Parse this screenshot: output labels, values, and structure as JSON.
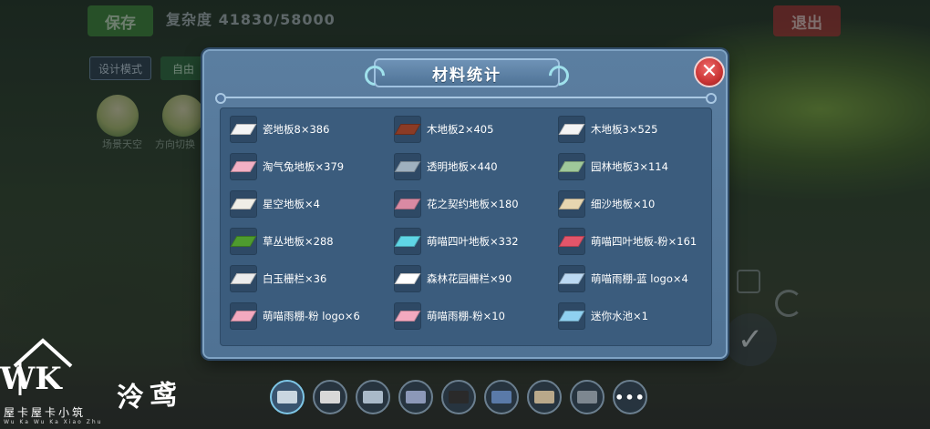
{
  "hud": {
    "save_label": "保存",
    "complexity": "复杂度 41830/58000",
    "exit_label": "退出",
    "design_mode_label": "设计模式",
    "free_mode_label": "自由",
    "tool_left_caption": "场景天空",
    "tool_right_caption": "方向切换"
  },
  "dialog": {
    "title": "材料统计",
    "close_glyph": "✕",
    "materials": [
      {
        "name": "瓷地板8×386",
        "tile_color": "#f4f4f4"
      },
      {
        "name": "木地板2×405",
        "tile_color": "#8b3b25"
      },
      {
        "name": "木地板3×525",
        "tile_color": "#f4f4f4"
      },
      {
        "name": "淘气兔地板×379",
        "tile_color": "#f2b0c4"
      },
      {
        "name": "透明地板×440",
        "tile_color": "#9fb1bf"
      },
      {
        "name": "园林地板3×114",
        "tile_color": "#9fc89a"
      },
      {
        "name": "星空地板×4",
        "tile_color": "#f0eee6"
      },
      {
        "name": "花之契约地板×180",
        "tile_color": "#d98aa3"
      },
      {
        "name": "细沙地板×10",
        "tile_color": "#e7d6b0"
      },
      {
        "name": "草丛地板×288",
        "tile_color": "#4e9b2e"
      },
      {
        "name": "萌喵四叶地板×332",
        "tile_color": "#5fd6e6"
      },
      {
        "name": "萌喵四叶地板-粉×161",
        "tile_color": "#e2556a"
      },
      {
        "name": "白玉栅栏×36",
        "tile_color": "#ececec"
      },
      {
        "name": "森林花园栅栏×90",
        "tile_color": "#ffffff"
      },
      {
        "name": "萌喵雨棚-蓝 logo×4",
        "tile_color": "#bcd9f2"
      },
      {
        "name": "萌喵雨棚-粉 logo×6",
        "tile_color": "#f3a9bf"
      },
      {
        "name": "萌喵雨棚-粉×10",
        "tile_color": "#f3a9bf"
      },
      {
        "name": "迷你水池×1",
        "tile_color": "#8fd0f0"
      }
    ]
  },
  "toolbar": {
    "items": [
      {
        "name": "eraser-tool",
        "color": "#c9d6e0"
      },
      {
        "name": "fence-tool",
        "color": "#d8d8d8"
      },
      {
        "name": "arch-tool",
        "color": "#a9b9c8"
      },
      {
        "name": "gate-tool",
        "color": "#8c98b8"
      },
      {
        "name": "dark-block-tool",
        "color": "#2a2a2a"
      },
      {
        "name": "trash-bin-tool",
        "color": "#5a7aa8"
      },
      {
        "name": "beige-tile-tool",
        "color": "#b9a88a"
      },
      {
        "name": "gray-tile-tool",
        "color": "#7d8790"
      }
    ],
    "more_label": "•••"
  },
  "watermark": {
    "letters": "WK",
    "subtitle": "屋卡屋卡小筑",
    "tiny_text": "Wu Ka Wu Ka Xiao Zhu",
    "signature": "泠鸢"
  }
}
